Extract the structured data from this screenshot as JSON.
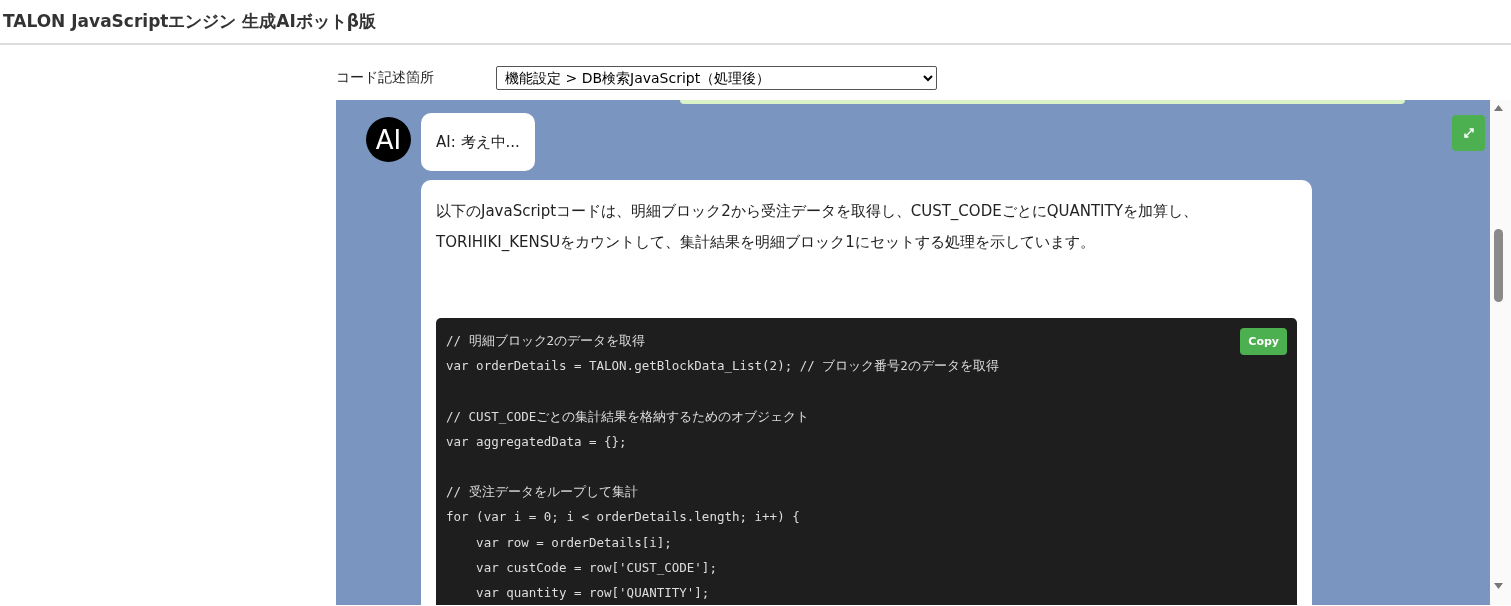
{
  "header": {
    "title": "TALON JavaScriptエンジン 生成AIボットβ版"
  },
  "code_location": {
    "label": "コード記述箇所",
    "value": "機能設定 > DB検索JavaScript（処理後）"
  },
  "chat": {
    "avatar": "AI",
    "status_message": "AI: 考え中...",
    "answer": {
      "text": "以下のJavaScriptコードは、明細ブロック2から受注データを取得し、CUST_CODEごとにQUANTITYを加算し、TORIHIKI_KENSUをカウントして、集計結果を明細ブロック1にセットする処理を示しています。",
      "copy_button": "Copy",
      "code": "// 明細ブロック2のデータを取得\nvar orderDetails = TALON.getBlockData_List(2); // ブロック番号2のデータを取得\n\n// CUST_CODEごとの集計結果を格納するためのオブジェクト\nvar aggregatedData = {};\n\n// 受注データをループして集計\nfor (var i = 0; i < orderDetails.length; i++) {\n    var row = orderDetails[i];\n    var custCode = row['CUST_CODE'];\n    var quantity = row['QUANTITY'];"
    }
  }
}
